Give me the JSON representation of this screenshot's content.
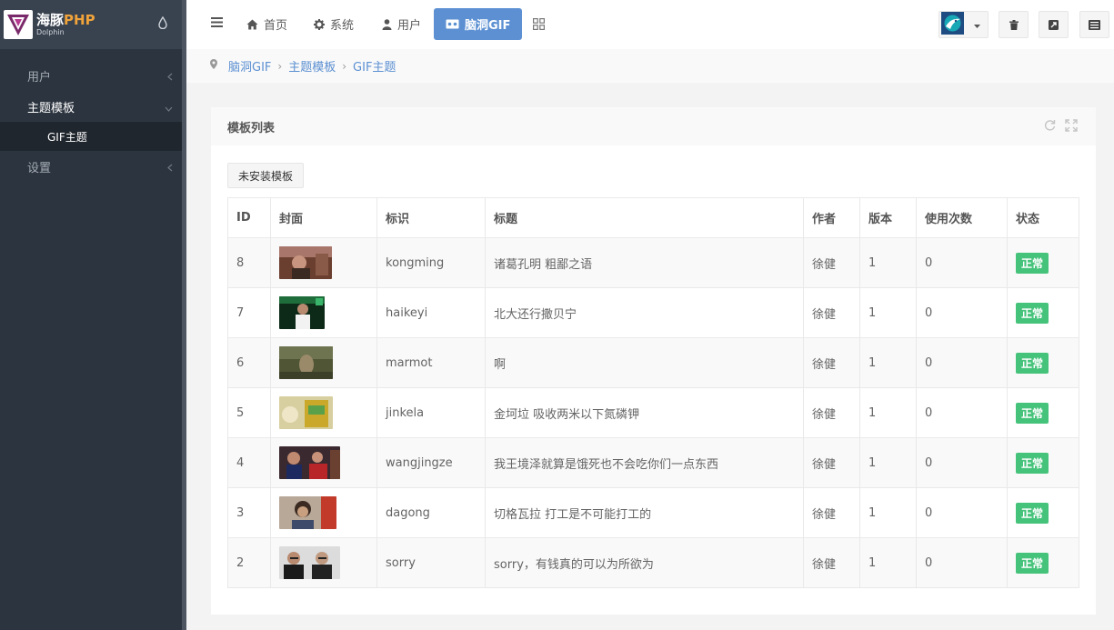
{
  "brand": {
    "name_cn": "海豚",
    "name_php": "PHP",
    "sub": "Dolphin"
  },
  "sidebar": {
    "items": [
      {
        "label": "用户"
      },
      {
        "label": "主题模板"
      },
      {
        "label": "GIF主题"
      },
      {
        "label": "设置"
      }
    ]
  },
  "header": {
    "nav": [
      {
        "label": "首页",
        "icon": "home-icon"
      },
      {
        "label": "系统",
        "icon": "gear-icon"
      },
      {
        "label": "用户",
        "icon": "user-icon"
      },
      {
        "label": "脑洞GIF",
        "icon": "gif-icon"
      }
    ]
  },
  "breadcrumb": [
    "脑洞GIF",
    "主题模板",
    "GIF主题"
  ],
  "block": {
    "title": "模板列表",
    "uninstalled_button": "未安装模板"
  },
  "table": {
    "headers": [
      "ID",
      "封面",
      "标识",
      "标题",
      "作者",
      "版本",
      "使用次数",
      "状态"
    ],
    "rows": [
      {
        "id": "8",
        "name": "kongming",
        "title": "诸葛孔明 粗鄙之语",
        "author": "徐健",
        "version": "1",
        "uses": "0",
        "status": "正常"
      },
      {
        "id": "7",
        "name": "haikeyi",
        "title": "北大还行撒贝宁",
        "author": "徐健",
        "version": "1",
        "uses": "0",
        "status": "正常"
      },
      {
        "id": "6",
        "name": "marmot",
        "title": "啊",
        "author": "徐健",
        "version": "1",
        "uses": "0",
        "status": "正常"
      },
      {
        "id": "5",
        "name": "jinkela",
        "title": "金坷垃 吸收两米以下氮磷钾",
        "author": "徐健",
        "version": "1",
        "uses": "0",
        "status": "正常"
      },
      {
        "id": "4",
        "name": "wangjingze",
        "title": "我王境泽就算是饿死也不会吃你们一点东西",
        "author": "徐健",
        "version": "1",
        "uses": "0",
        "status": "正常"
      },
      {
        "id": "3",
        "name": "dagong",
        "title": "切格瓦拉 打工是不可能打工的",
        "author": "徐健",
        "version": "1",
        "uses": "0",
        "status": "正常"
      },
      {
        "id": "2",
        "name": "sorry",
        "title": "sorry，有钱真的可以为所欲为",
        "author": "徐健",
        "version": "1",
        "uses": "0",
        "status": "正常"
      }
    ]
  },
  "colors": {
    "sidebar_bg": "#2c343f",
    "accent": "#5c90d2",
    "success": "#46c37b"
  }
}
